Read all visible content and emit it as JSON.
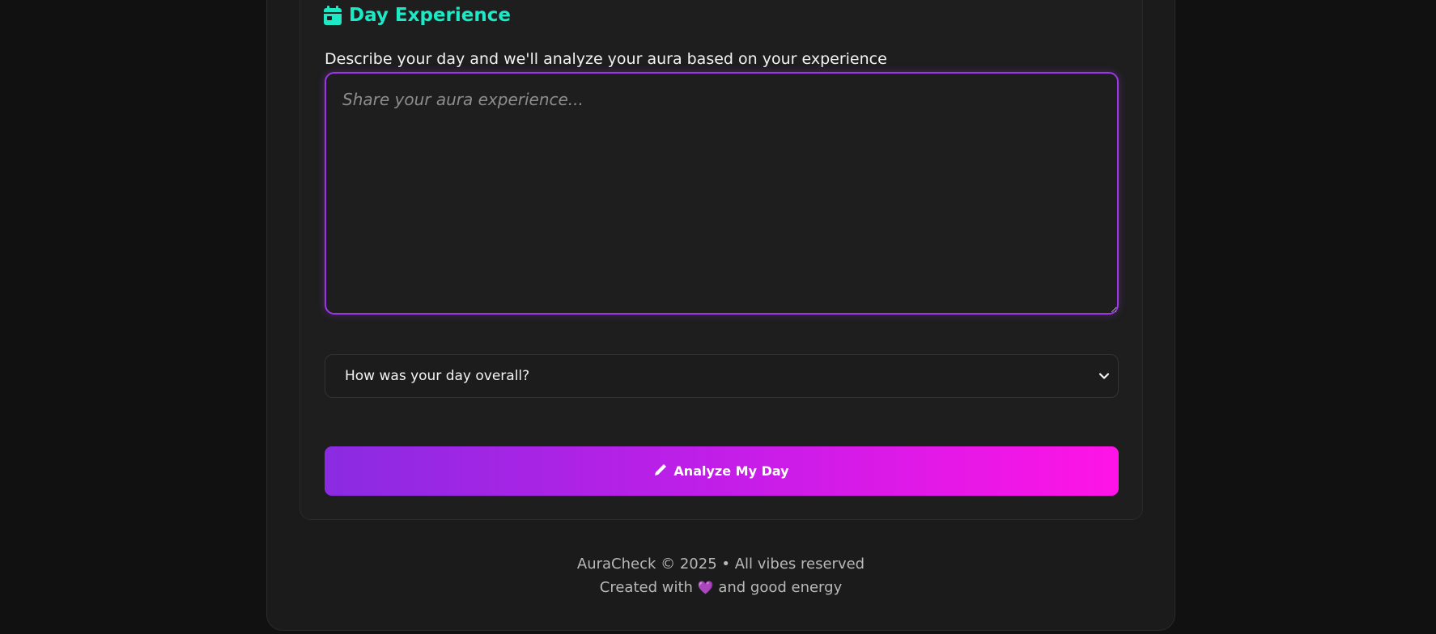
{
  "section": {
    "title": "Day Experience",
    "icon": "calendar-icon",
    "accent_color": "#1de9c6"
  },
  "form": {
    "description": "Describe your day and we'll analyze your aura based on your experience",
    "experience_placeholder": "Share your aura experience...",
    "experience_value": "",
    "day_rating_selected": "How was your day overall?",
    "analyze_button_label": "Analyze My Day",
    "analyze_button_icon": "pencil-icon",
    "gradient_start": "#8a2be2",
    "gradient_end": "#ff14e6"
  },
  "footer": {
    "line1": "AuraCheck © 2025 • All vibes reserved",
    "line2_before": "Created with",
    "heart": "💜",
    "line2_after": "and good energy"
  }
}
